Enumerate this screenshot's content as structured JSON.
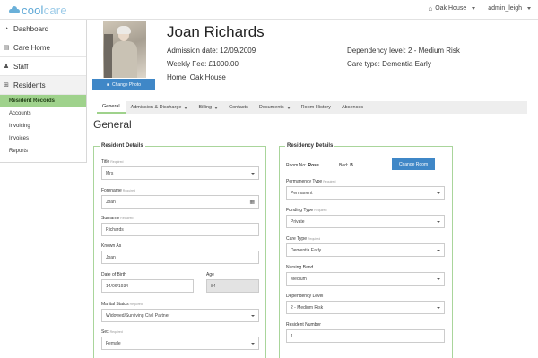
{
  "app": {
    "logo_left": "cool",
    "logo_right": "care",
    "home_selector": "Oak House",
    "user_menu": "admin_leigh"
  },
  "sidebar": {
    "items": [
      {
        "label": "Dashboard",
        "icon": "tachometer-icon"
      },
      {
        "label": "Care Home",
        "icon": "building-icon"
      },
      {
        "label": "Staff",
        "icon": "people-icon"
      },
      {
        "label": "Residents",
        "icon": "plus-square-icon"
      }
    ],
    "subitems": [
      {
        "label": "Resident Records",
        "active": true
      },
      {
        "label": "Accounts"
      },
      {
        "label": "Invoicing"
      },
      {
        "label": "Invoices"
      },
      {
        "label": "Reports"
      }
    ]
  },
  "profile": {
    "name": "Joan Richards",
    "change_photo_label": "Change Photo",
    "admission_date": "Admission date: 12/09/2009",
    "weekly_fee": "Weekly Fee: £1000.00",
    "home": "Home: Oak House",
    "dependency_level": "Dependency level: 2 - Medium Risk",
    "care_type": "Care type: Dementia Early"
  },
  "tabs": [
    {
      "label": "General",
      "active": true,
      "dropdown": false
    },
    {
      "label": "Admission & Discharge",
      "dropdown": true
    },
    {
      "label": "Billing",
      "dropdown": true
    },
    {
      "label": "Contacts",
      "dropdown": false
    },
    {
      "label": "Documents",
      "dropdown": true
    },
    {
      "label": "Room History",
      "dropdown": false
    },
    {
      "label": "Absences",
      "dropdown": false
    }
  ],
  "section_title": "General",
  "required_tag": "Required",
  "resident_details": {
    "legend": "Resident Details",
    "title": {
      "label": "Title",
      "value": "Mrs"
    },
    "forename": {
      "label": "Forename",
      "value": "Joan"
    },
    "surname": {
      "label": "Surname",
      "value": "Richards"
    },
    "known_as": {
      "label": "Known As",
      "value": "Joan"
    },
    "dob": {
      "label": "Date of Birth",
      "value": "14/06/1934"
    },
    "age": {
      "label": "Age",
      "value": "84"
    },
    "marital": {
      "label": "Marital Status",
      "value": "Widowed/Surviving Civil Partner"
    },
    "sex": {
      "label": "Sex",
      "value": "Female"
    }
  },
  "residency_details": {
    "legend": "Residency Details",
    "room_no_label": "Room No:",
    "room_no": "Rose",
    "bed_label": "Bed:",
    "bed": "B",
    "change_room_label": "Change Room",
    "permanency": {
      "label": "Permanency Type",
      "value": "Permanent"
    },
    "funding": {
      "label": "Funding Type",
      "value": "Private"
    },
    "care_type": {
      "label": "Care Type",
      "value": "Dementia Early"
    },
    "nursing_band": {
      "label": "Nursing Band",
      "value": "Medium"
    },
    "dependency": {
      "label": "Dependency Level",
      "value": "2 - Medium Risk"
    },
    "resident_number": {
      "label": "Resident Number",
      "value": "1"
    }
  }
}
